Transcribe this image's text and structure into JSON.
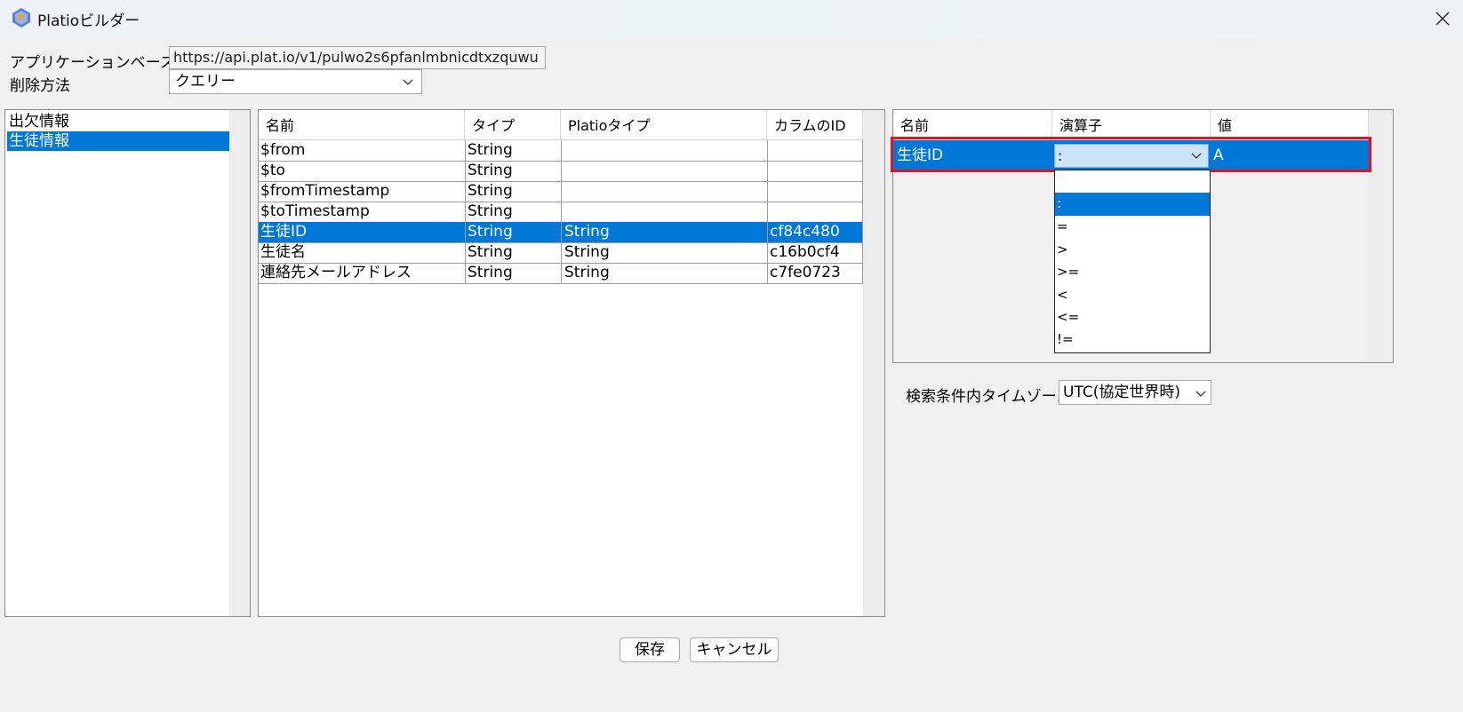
{
  "window": {
    "title": "Platioビルダー",
    "close_icon": "close-icon",
    "app_icon": "platio-app-icon"
  },
  "form": {
    "base_url_label": "アプリケーションベースURL",
    "base_url_value": "https://api.plat.io/v1/pulwo2s6pfanlmbnicdtxzquwu",
    "delete_method_label": "削除方法",
    "delete_method_value": "クエリー"
  },
  "collections": {
    "items": [
      {
        "label": "出欠情報",
        "selected": false
      },
      {
        "label": "生徒情報",
        "selected": true
      }
    ]
  },
  "columns_table": {
    "headers": [
      "名前",
      "タイプ",
      "Platioタイプ",
      "カラムのID"
    ],
    "rows": [
      {
        "name": "$from",
        "type": "String",
        "platio_type": "",
        "column_id": "",
        "selected": false
      },
      {
        "name": "$to",
        "type": "String",
        "platio_type": "",
        "column_id": "",
        "selected": false
      },
      {
        "name": "$fromTimestamp",
        "type": "String",
        "platio_type": "",
        "column_id": "",
        "selected": false
      },
      {
        "name": "$toTimestamp",
        "type": "String",
        "platio_type": "",
        "column_id": "",
        "selected": false
      },
      {
        "name": "生徒ID",
        "type": "String",
        "platio_type": "String",
        "column_id": "cf84c480",
        "selected": true
      },
      {
        "name": "生徒名",
        "type": "String",
        "platio_type": "String",
        "column_id": "c16b0cf4",
        "selected": false
      },
      {
        "name": "連絡先メールアドレス",
        "type": "String",
        "platio_type": "String",
        "column_id": "c7fe0723",
        "selected": false
      }
    ]
  },
  "filter_table": {
    "headers": [
      "名前",
      "演算子",
      "値"
    ],
    "row": {
      "name": "生徒ID",
      "operator": ":",
      "value": "A"
    },
    "highlight_color": "#e81123"
  },
  "operator_dropdown": {
    "options": [
      "",
      ":",
      "=",
      ">",
      ">=",
      "<",
      "<=",
      "!="
    ],
    "selected_index": 1
  },
  "timezone": {
    "label": "検索条件内タイムゾーン",
    "value": "UTC(協定世界時)"
  },
  "buttons": {
    "save": "保存",
    "cancel": "キャンセル"
  },
  "colors": {
    "selection": "#0078d7",
    "panel_bg": "#f0f0f0"
  }
}
